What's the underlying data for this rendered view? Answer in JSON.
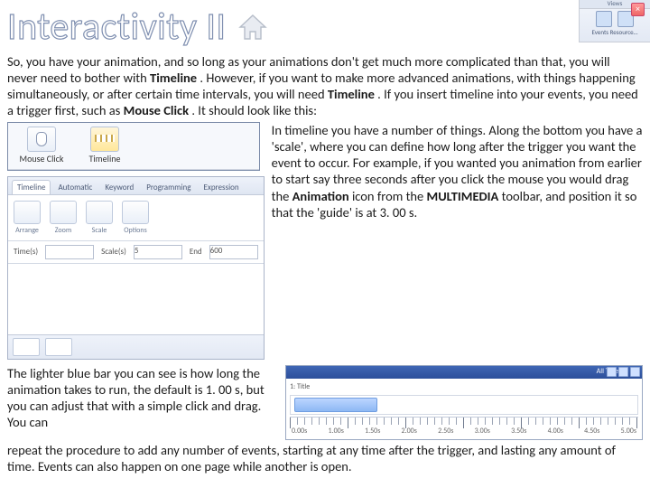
{
  "title": "Interactivity II",
  "ribbon": {
    "group_label": "Views",
    "item_label": "Events Resource…"
  },
  "p1_a": "So, you have your animation, and so long as your animations don't get much more complicated than that, you will never need to bother with ",
  "p1_b1": "Timeline",
  "p1_c": ".  However, if you want to make more advanced animations, with things happening simultaneously, or after certain time intervals, you will need ",
  "p1_b2": "Timeline",
  "p1_d": ".  If you insert timeline into your events, you need a trigger first, such as ",
  "p1_b3": "Mouse Click",
  "p1_e": ".  It should look like this:",
  "events": {
    "trigger_label": "Mouse Click",
    "timeline_label": "Timeline",
    "close_x": "×"
  },
  "tl": {
    "tabs": [
      "Timeline",
      "Automatic",
      "Keyword",
      "Programming",
      "Expression"
    ],
    "tool_labels": [
      "Arrange",
      "Zoom",
      "Scale",
      "Options"
    ],
    "field1_label": "Time(s)",
    "field2_label": "Scale(s)",
    "field3_label": "End",
    "val1": "",
    "val2": "5",
    "val3": "600"
  },
  "mid_a": "In timeline you have a number of things.  Along the bottom you have a 'scale', where you can define how long after the trigger you want the event to occur.  For example, if you wanted you animation from earlier to start say three seconds after you click the mouse you would drag the ",
  "mid_b1": "Animation",
  "mid_c": " icon from the ",
  "mid_b2": "MULTIMEDIA",
  "mid_d": " toolbar, and position it so that the 'guide' is at 3. 00 s.",
  "p3_a": "The lighter blue bar you can see is how long the animation takes to run, the default is 1. 00 s, but you can adjust that with a simple click and drag.  You can ",
  "p3_b": "repeat the procedure to add any number of events, starting at any time after the trigger, and lasting any amount of time.  Events can also happen on one page while another is open.",
  "ruler": {
    "caption": "All Title",
    "row_label": "1: Title",
    "ticks": [
      "0.00s",
      "1.00s",
      "1.50s",
      "2.00s",
      "2.50s",
      "3.00s",
      "3.50s",
      "4.00s",
      "4.50s",
      "5.00s"
    ]
  }
}
